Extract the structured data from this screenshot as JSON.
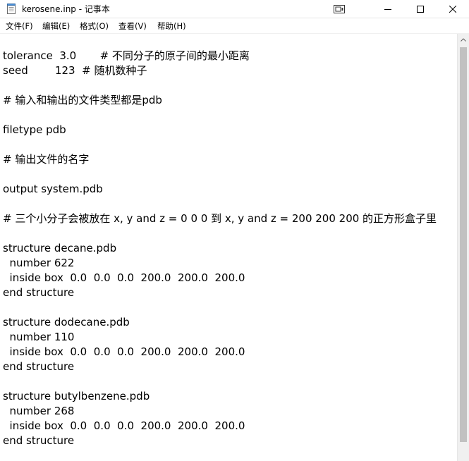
{
  "window": {
    "title": "kerosene.inp - 记事本",
    "icon": "notepad-icon"
  },
  "titlebar_buttons": {
    "extra": "tablet-icon",
    "minimize": "minimize-icon",
    "maximize": "maximize-icon",
    "close": "close-icon"
  },
  "menu": {
    "file": "文件(F)",
    "edit": "编辑(E)",
    "format": "格式(O)",
    "view": "查看(V)",
    "help": "帮助(H)"
  },
  "editor": {
    "content": "tolerance  3.0       # 不同分子的原子间的最小距离\nseed        123  # 随机数种子\n\n# 输入和输出的文件类型都是pdb\n\nfiletype pdb\n\n# 输出文件的名字\n\noutput system.pdb\n\n# 三个小分子会被放在 x, y and z = 0 0 0 到 x, y and z = 200 200 200 的正方形盒子里\n\nstructure decane.pdb\n  number 622\n  inside box  0.0  0.0  0.0  200.0  200.0  200.0\nend structure\n\nstructure dodecane.pdb\n  number 110\n  inside box  0.0  0.0  0.0  200.0  200.0  200.0\nend structure\n\nstructure butylbenzene.pdb\n  number 268\n  inside box  0.0  0.0  0.0  200.0  200.0  200.0\nend structure"
  }
}
